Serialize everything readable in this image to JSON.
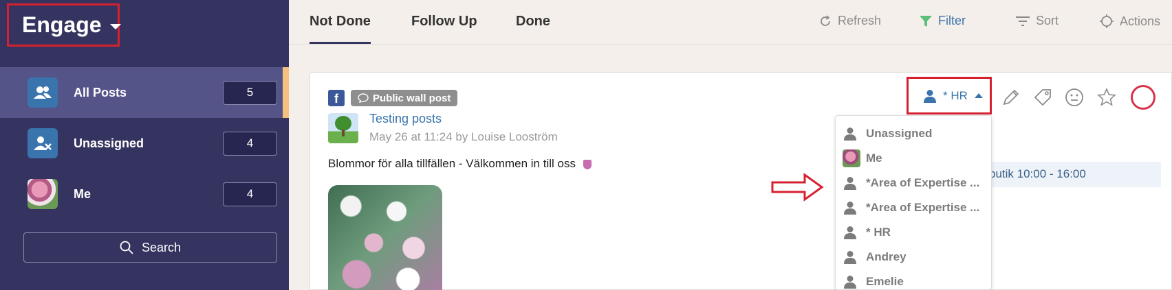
{
  "sidebar": {
    "brand": "Engage",
    "items": [
      {
        "label": "All Posts",
        "count": "5"
      },
      {
        "label": "Unassigned",
        "count": "4"
      },
      {
        "label": "Me",
        "count": "4"
      }
    ],
    "search_label": "Search"
  },
  "tabs": [
    "Not Done",
    "Follow Up",
    "Done"
  ],
  "toolbar": {
    "refresh": "Refresh",
    "filter": "Filter",
    "sort": "Sort",
    "actions": "Actions"
  },
  "post": {
    "badge": "Public wall post",
    "title": "Testing posts",
    "meta": "May 26 at 11:24 by Louise Looström",
    "text": "Blommor för alla tillfällen - Välkommen in till oss",
    "info": "butik 10:00 - 16:00",
    "assignee": "* HR"
  },
  "assign_dropdown": {
    "options": [
      "Unassigned",
      "Me",
      "*Area of Expertise ...",
      "*Area of Expertise ...",
      "* HR",
      "Andrey",
      "Emelie"
    ]
  },
  "colors": {
    "sidebar_bg": "#353460",
    "active_item_bg": "#545489",
    "accent_blue": "#3a74ad",
    "highlight_red": "#d6202f",
    "filter_green": "#5bbf7a"
  }
}
